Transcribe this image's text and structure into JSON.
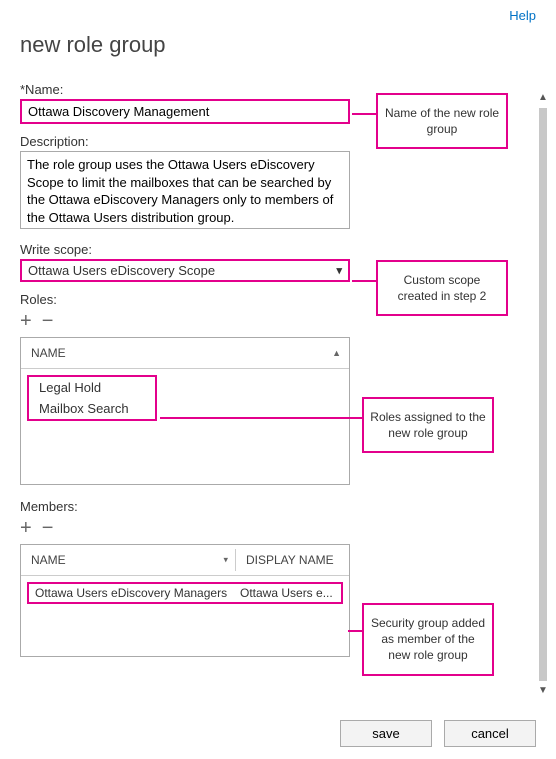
{
  "help_link": "Help",
  "page_title": "new role group",
  "name": {
    "label": "*Name:",
    "value": "Ottawa Discovery Management"
  },
  "description": {
    "label": "Description:",
    "value": "The role group uses the Ottawa Users eDiscovery Scope to limit the mailboxes that can be searched by the Ottawa eDiscovery Managers only to members of the Ottawa Users distribution group."
  },
  "write_scope": {
    "label": "Write scope:",
    "selected": "Ottawa Users eDiscovery Scope"
  },
  "roles": {
    "label": "Roles:",
    "header": "NAME",
    "items": [
      "Legal Hold",
      "Mailbox Search"
    ]
  },
  "members": {
    "label": "Members:",
    "columns": [
      "NAME",
      "DISPLAY NAME"
    ],
    "rows": [
      {
        "name": "Ottawa Users eDiscovery Managers",
        "display": "Ottawa Users e..."
      }
    ]
  },
  "callouts": {
    "name": "Name of the new role group",
    "scope": "Custom scope created in step 2",
    "roles": "Roles assigned to the new role group",
    "members": "Security group added as member of the new role group"
  },
  "buttons": {
    "save": "save",
    "cancel": "cancel"
  }
}
